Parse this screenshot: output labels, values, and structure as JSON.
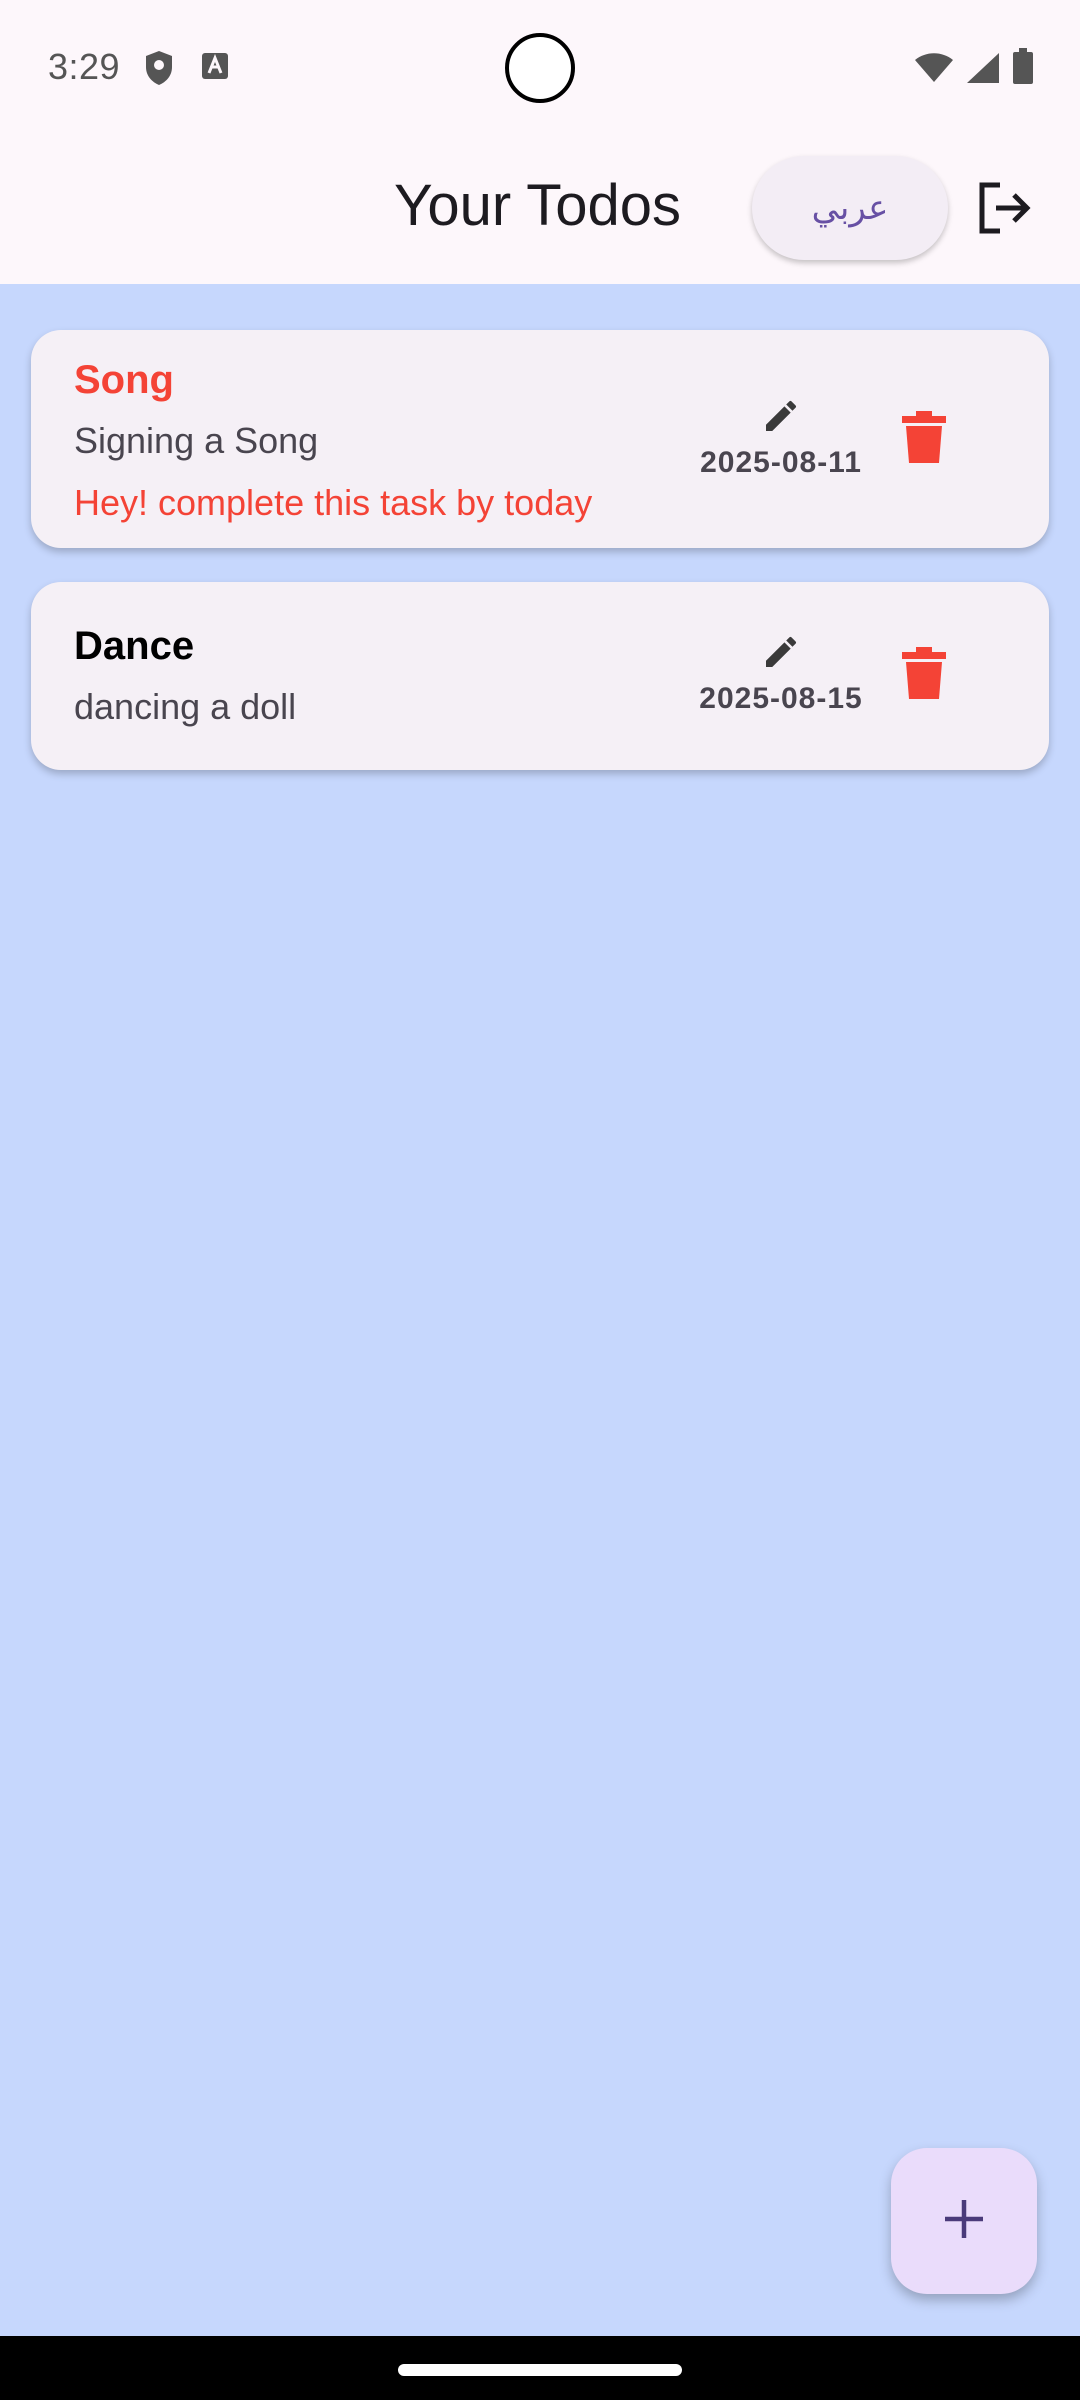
{
  "status_bar": {
    "time": "3:29",
    "icons": [
      "shield-icon",
      "keyboard-icon",
      "wifi-icon",
      "signal-icon",
      "battery-icon"
    ]
  },
  "app_bar": {
    "title": "Your Todos",
    "language_button_label": "عربي",
    "logout_icon": "logout-icon"
  },
  "todos": [
    {
      "title": "Song",
      "description": "Signing a Song",
      "warning": "Hey! complete this task by today",
      "date": "2025-08-11",
      "title_color": "#f44336"
    },
    {
      "title": "Dance",
      "description": "dancing a doll",
      "warning": "",
      "date": "2025-08-15",
      "title_color": "#000000"
    }
  ],
  "fab": {
    "icon": "add-icon"
  },
  "colors": {
    "background": "#c6d7fd",
    "app_bar": "#fdf7fb",
    "card": "#f5f0f6",
    "danger": "#f44336",
    "accent": "#6750a4"
  }
}
